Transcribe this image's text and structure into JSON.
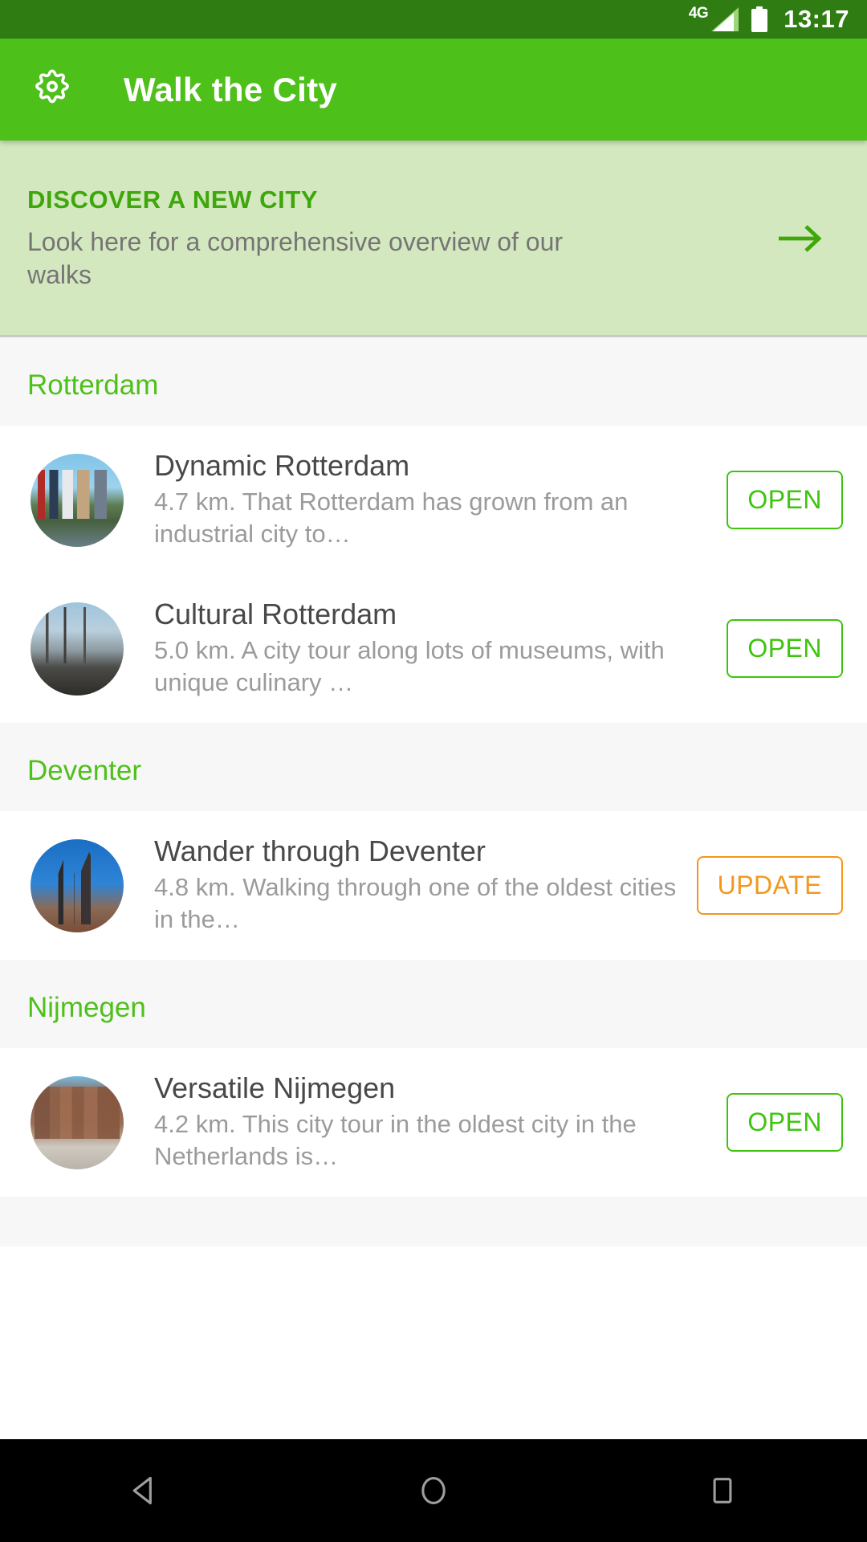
{
  "status_bar": {
    "network_label": "4G",
    "time": "13:17",
    "signal_icon": "signal-bars-icon",
    "battery_icon": "battery-icon",
    "background_color": "#2f7d12"
  },
  "app_bar": {
    "settings_icon": "gear-icon",
    "title": "Walk the City",
    "background_color": "#4ec01a"
  },
  "banner": {
    "title": "DISCOVER A NEW CITY",
    "subtitle": "Look here for a comprehensive overview of our walks",
    "arrow_icon": "arrow-right-icon",
    "background_color": "#d4e8c0",
    "title_color": "#3fa60b"
  },
  "colors": {
    "open_button": "#3ec40f",
    "update_button": "#f3971d",
    "section_title": "#4ec01a",
    "walk_title": "#484848",
    "walk_description": "#9b9b9b"
  },
  "sections": [
    {
      "city": "Rotterdam",
      "walks": [
        {
          "name": "Dynamic Rotterdam",
          "description": "4.7 km. That Rotterdam has grown from an industrial city to…",
          "action": "OPEN",
          "action_type": "open",
          "thumbnail": "rotterdam-skyline-thumbnail"
        },
        {
          "name": "Cultural Rotterdam",
          "description": "5.0 km. A city tour along lots of museums, with unique culinary …",
          "action": "OPEN",
          "action_type": "open",
          "thumbnail": "rotterdam-harbour-thumbnail"
        }
      ]
    },
    {
      "city": "Deventer",
      "walks": [
        {
          "name": "Wander through Deventer",
          "description": "4.8 km. Walking through one of the oldest cities in the…",
          "action": "UPDATE",
          "action_type": "update",
          "thumbnail": "deventer-church-thumbnail"
        }
      ]
    },
    {
      "city": "Nijmegen",
      "walks": [
        {
          "name": "Versatile Nijmegen",
          "description": "4.2 km. This city tour in the oldest city in the Netherlands is…",
          "action": "OPEN",
          "action_type": "open",
          "thumbnail": "nijmegen-square-thumbnail"
        }
      ]
    }
  ],
  "nav_bar": {
    "back_icon": "back-triangle-icon",
    "home_icon": "home-circle-icon",
    "recents_icon": "recents-square-icon",
    "background_color": "#000000"
  }
}
